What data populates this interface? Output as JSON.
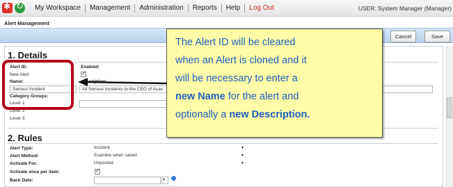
{
  "nav": {
    "items": [
      "My Workspace",
      "Management",
      "Administration",
      "Reports",
      "Help"
    ],
    "logout": "Log Out",
    "user": "USER: System Manager (Manager)"
  },
  "page": {
    "title": "Alert Management"
  },
  "toolbar": {
    "cancel_label": "Cancel",
    "save_label": "Save"
  },
  "details": {
    "heading": "1. Details",
    "alert_id_label": "Alert ID:",
    "alert_id_value": "New Alert",
    "enabled_label": "Enabled:",
    "name_label": "Name:",
    "name_value": "Serious Incident",
    "description_label": "scription:",
    "description_value": "All Serious Incidents to the CEO of Acac",
    "category_groups_label": "Category Groups:",
    "level1_label": "Level 1:",
    "level2_label": "Level 2:",
    "level3_label": "Level 3:"
  },
  "rules": {
    "heading": "2. Rules",
    "alert_type_label": "Alert Type:",
    "alert_type_value": "Incident",
    "alert_method_label": "Alert Method:",
    "alert_method_value": "Examine when saved",
    "activate_for_label": "Activate For:",
    "activate_for_value": "Unposted",
    "activate_once_label": "Activate once per item:",
    "back_date_label": "Back Date:"
  },
  "callout": {
    "line1": "The Alert ID will be cleared",
    "line2": "when an Alert is cloned and it",
    "line3": "will be necessary to enter a",
    "line4_bold": "new Name",
    "line4_rest": " for the alert and",
    "line5_plain": "optionally a ",
    "line5_bold": "new Description."
  },
  "colors": {
    "callout_bg": "#fffca8",
    "callout_text": "#1f5fbf",
    "highlight_border": "#b3001b",
    "logout": "#d42a1e"
  }
}
